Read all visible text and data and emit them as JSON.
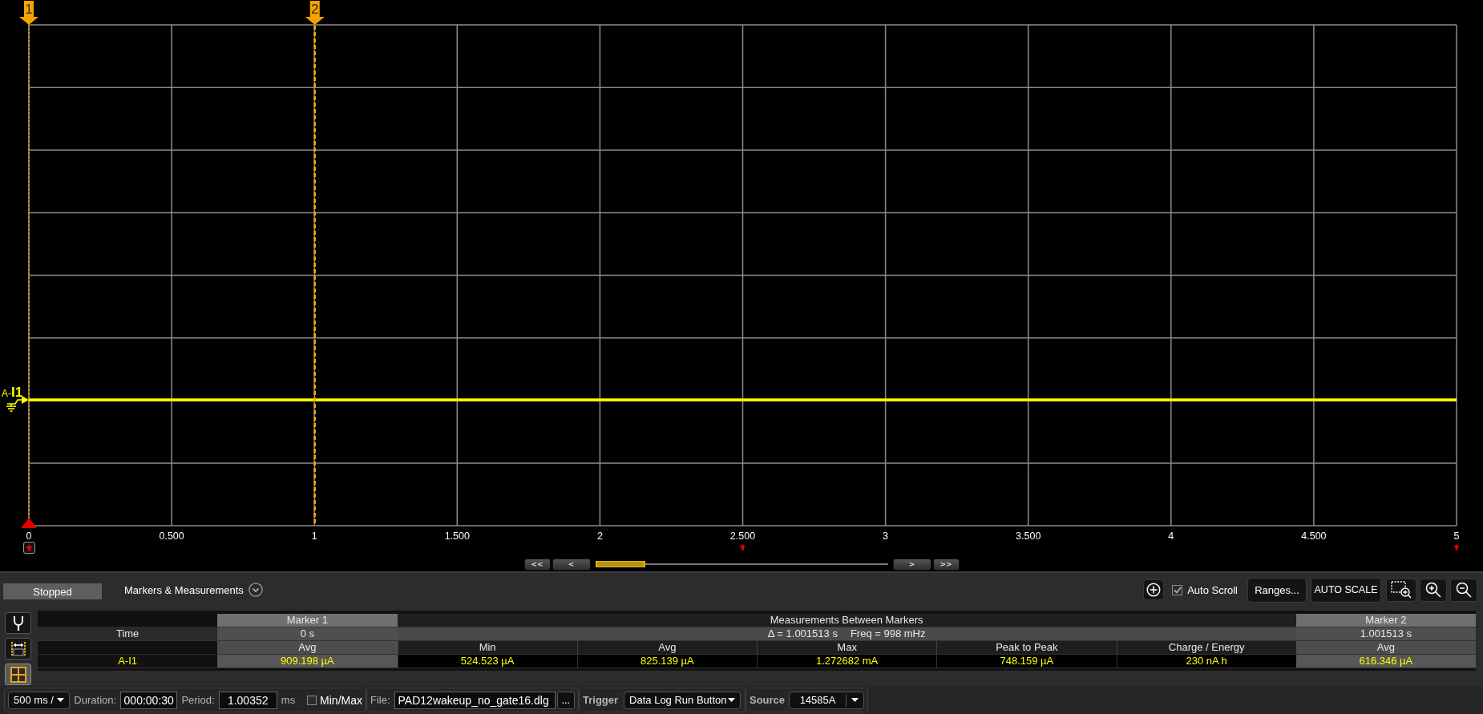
{
  "plot": {
    "markers": [
      {
        "label": "1",
        "selected": false
      },
      {
        "label": "2",
        "selected": true
      }
    ],
    "trace": {
      "prefix": "A-",
      "channel": "I1"
    },
    "x_axis": {
      "labels": [
        "0",
        "0.500",
        "1",
        "1.500",
        "2",
        "2.500",
        "3",
        "3.500",
        "4",
        "4.500",
        "5"
      ]
    },
    "navigator": {
      "back_buttons": [
        "<<",
        "<"
      ],
      "forward_buttons": [
        ">",
        ">>"
      ]
    }
  },
  "panel": {
    "status": "Stopped",
    "title": "Markers & Measurements"
  },
  "toolbar": {
    "auto_scroll": {
      "label": "Auto Scroll",
      "checked": true
    },
    "buttons": [
      "Ranges...",
      "AUTO SCALE"
    ]
  },
  "side_tools": [
    {
      "kind": "probe",
      "selected": false
    },
    {
      "kind": "span",
      "selected": false
    },
    {
      "kind": "grid",
      "selected": true
    }
  ],
  "table": {
    "header": {
      "marker_1": "Marker 1",
      "between": "Measurements Between Markers",
      "marker_2": "Marker 2"
    },
    "time_row": {
      "label": "Time",
      "marker_1": "0 s",
      "delta": "Δ = 1.001513 s",
      "freq": "Freq = 998 mHz",
      "marker_2": "1.001513 s"
    },
    "columns": [
      "Avg",
      "Min",
      "Avg",
      "Max",
      "Peak to Peak",
      "Charge / Energy",
      "Avg"
    ],
    "rows": [
      {
        "label": "A-I1",
        "values": [
          "909.198 µA",
          "524.523 µA",
          "825.139 µA",
          "1.272682 mA",
          "748.159 µA",
          "230 nA h",
          "616.346 µA"
        ]
      }
    ]
  },
  "status_bar": {
    "timebase": "500 ms /",
    "duration": {
      "label": "Duration:",
      "value": "000:00:30"
    },
    "period": {
      "label": "Period:",
      "value": "1.00352",
      "unit": "ms"
    },
    "min_max": {
      "label": "Min/Max",
      "checked": false
    },
    "file": {
      "label": "File:",
      "value": "PAD12wakeup_no_gate16.dlg",
      "browse": "..."
    },
    "trigger": {
      "label": "Trigger",
      "value": "Data Log Run Button"
    },
    "source": {
      "label": "Source",
      "value": "14585A"
    }
  }
}
